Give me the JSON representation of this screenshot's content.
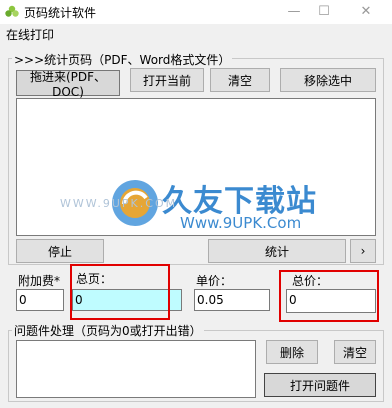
{
  "window": {
    "title": "页码统计软件",
    "minimize": "—",
    "maximize": "☐",
    "close": "✕"
  },
  "menu": {
    "item1": "在线打印"
  },
  "count_group": {
    "legend": ">>>统计页码（PDF、Word格式文件）",
    "drop_label": "拖进来(PDF、DOC)",
    "open_current": "打开当前",
    "clear": "清空",
    "remove_selected": "移除选中",
    "stop": "停止",
    "count": "统计",
    "next": "›"
  },
  "fields": {
    "surcharge_label": "附加费*",
    "surcharge_value": "0",
    "total_pages_label": "总页：",
    "total_pages_value": "0",
    "unit_price_label": "单价：",
    "unit_price_value": "0.05",
    "total_price_label": "总价：",
    "total_price_value": "0"
  },
  "problem_group": {
    "legend": "问题件处理（页码为0或打开出错）",
    "delete": "删除",
    "clear": "清空",
    "open_problem": "打开问题件"
  },
  "watermark": {
    "main": "久友下载站",
    "url": "Www.9UPK.Com",
    "left": "WWW.9UPK.COM"
  },
  "colors": {
    "highlight_field": "#bffcff",
    "annotation_red": "#e10000",
    "watermark_blue": "#1a76c8"
  }
}
